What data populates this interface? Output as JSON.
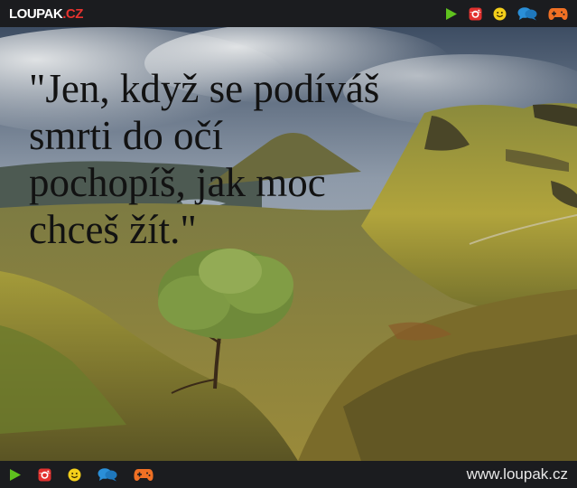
{
  "header": {
    "logo_main": "LOUPAK",
    "logo_tld": ".CZ",
    "icons": [
      "play-icon",
      "instagram-icon",
      "smiley-icon",
      "chat-icon",
      "gamepad-icon"
    ]
  },
  "content": {
    "quote_lines": [
      "\"Jen, když se podíváš",
      "smrti do očí",
      "pochopíš, jak moc",
      "chceš žít.\""
    ]
  },
  "footer": {
    "icons": [
      "play-icon",
      "instagram-icon",
      "smiley-icon",
      "chat-icon",
      "gamepad-icon"
    ],
    "site_url": "www.loupak.cz"
  },
  "colors": {
    "bar_bg": "#1b1c1f",
    "play": "#5fc21e",
    "instagram": "#e2322f",
    "smiley": "#f4cf1a",
    "chat": "#2a8fd8",
    "gamepad": "#f07024"
  }
}
